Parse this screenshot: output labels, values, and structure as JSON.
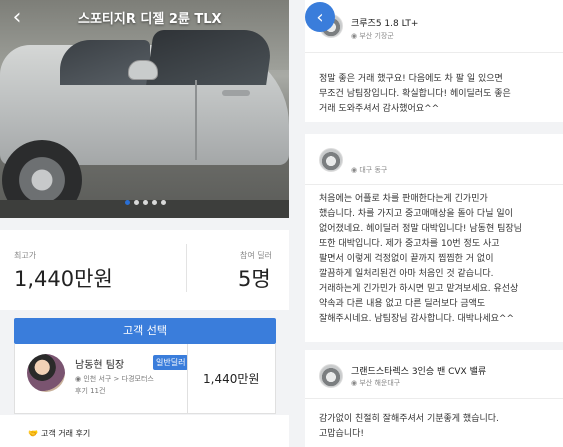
{
  "left": {
    "title": "스포티지R 디젤 2륜 TLX",
    "back_icon": "chevron-left-icon",
    "carousel_count": 5,
    "carousel_active": 0,
    "price_label": "최고가",
    "price_value": "1,440만원",
    "count_label": "참여 딜러",
    "count_value": "5명",
    "select_button": "고객 선택",
    "dealer": {
      "name": "남동현 팀장",
      "badge": "일반딜러",
      "location": "인천 서구 > 다경모터스",
      "reviews": "후기 11건",
      "price": "1,440만원"
    },
    "trade_review_label": "고객 거래 후기"
  },
  "right": {
    "back_icon": "chevron-left-icon",
    "reviews": [
      {
        "model": "크루즈5 1.8 LT+",
        "location": "부산 기장군",
        "lines": [
          "정말 좋은 거래 했구요! 다음에도 차 팔 일 있으면",
          "무조건 남팀장입니다. 확실합니다! 헤이딜러도 좋은",
          "거래 도와주셔서 감사했어요^^"
        ]
      },
      {
        "model": "",
        "location": "대구 동구",
        "lines": [
          "처음에는 어플로 차를 판매한다는게 긴가민가",
          "했습니다. 차를 가지고 중고매매상을 돌아 다닐 일이",
          "없어졌네요. 헤이딜러 정말 대박입니다! 남동현 팀장님",
          "또한 대박입니다. 제가 중고차를 10번 정도 사고",
          "팔면서 이렇게 걱정없이 끝까지 찝찝한 거 없이",
          "깔끔하게 일처리된건 아마 처음인 것 같습니다.",
          "거래하는게 긴가민가 하시면 믿고 맡겨보세요. 유선상",
          "약속과 다른 내용 없고 다른 딜러보다 금액도",
          "잘해주시네요. 남팀장님 감사합니다. 대박나세요^^"
        ]
      },
      {
        "model": "그랜드스타렉스 3인승 밴 CVX 밸류",
        "location": "부산 해운대구",
        "lines": [
          "감가없이 친절히 잘해주셔서 기분좋게 했습니다.",
          "고맙습니다!"
        ]
      }
    ]
  },
  "colors": {
    "accent": "#3a7ddb",
    "panel_bg": "#f2f3f5"
  }
}
